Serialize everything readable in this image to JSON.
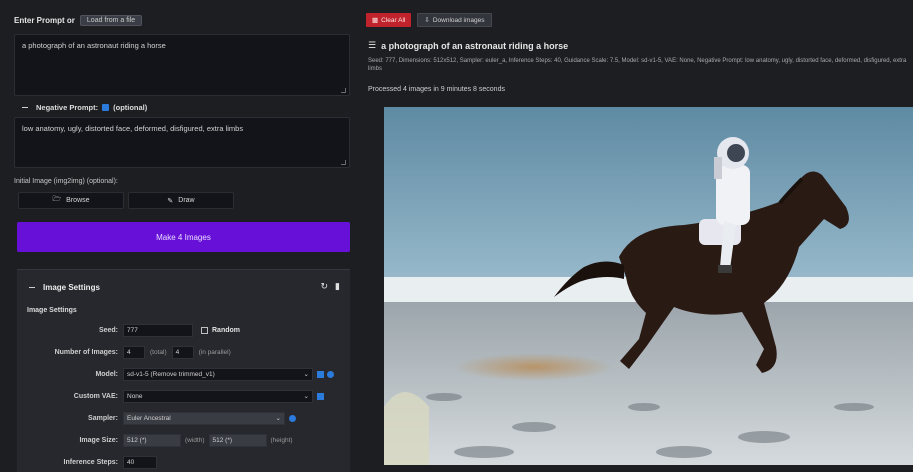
{
  "prompt": {
    "label": "Enter Prompt or",
    "load_button": "Load from a file",
    "text": "a photograph of an astronaut riding a horse"
  },
  "negative_prompt": {
    "label": "Negative Prompt:",
    "optional": "(optional)",
    "text": "low anatomy, ugly, distorted face, deformed, disfigured, extra limbs"
  },
  "init_image": {
    "label": "Initial Image (img2img) (optional):",
    "browse_label": "Browse",
    "draw_label": "Draw"
  },
  "make_button": "Make 4 Images",
  "settings": {
    "title": "Image Settings",
    "subtitle": "Image Settings",
    "seed_label": "Seed:",
    "seed_value": "777",
    "random_label": "Random",
    "num_images_label": "Number of Images:",
    "num_images_total": "4",
    "total_label": "(total)",
    "num_parallel": "4",
    "parallel_label": "(in parallel)",
    "model_label": "Model:",
    "model_value": "sd-v1-5 (Remove trimmed_v1)",
    "custom_vae_label": "Custom VAE:",
    "custom_vae_value": "None",
    "sampler_label": "Sampler:",
    "sampler_value": "Euler Ancestral",
    "image_size_label": "Image Size:",
    "width_value": "512 (*)",
    "width_label": "(width)",
    "height_value": "512 (*)",
    "height_label": "(height)",
    "steps_label": "Inference Steps:",
    "steps_value": "40"
  },
  "toolbar": {
    "clear_label": "Clear All",
    "download_label": "Download images"
  },
  "result": {
    "title": "a photograph of an astronaut riding a horse",
    "meta": "Seed: 777, Dimensions: 512x512, Sampler: euler_a, Inference Steps: 40, Guidance Scale: 7.5, Model: sd-v1-5, VAE: None, Negative Prompt: low anatomy, ugly, distorted face, deformed, disfigured, extra limbs",
    "time": "Processed 4 images in 9 minutes 8 seconds"
  },
  "colors": {
    "accent_purple": "#6610d8",
    "danger_red": "#c0232b",
    "info_blue": "#2a7bdc",
    "panel_bg": "#1d1e22"
  }
}
